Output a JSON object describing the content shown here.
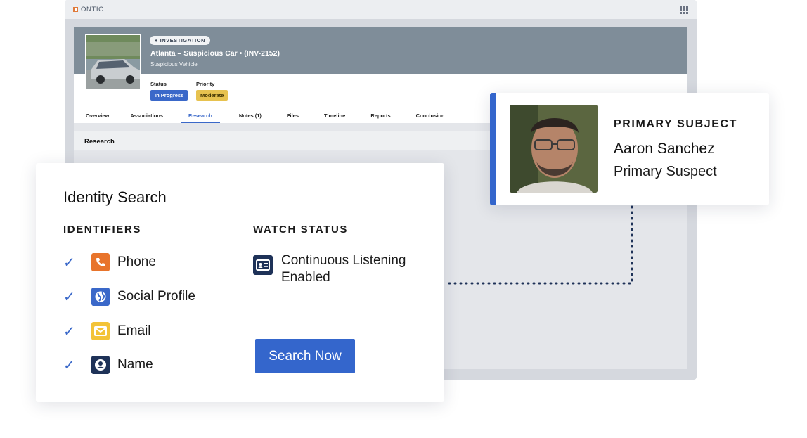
{
  "app": {
    "brand": "ONTIC"
  },
  "case": {
    "badge": "INVESTIGATION",
    "title": "Atlanta – Suspicious Car • (INV-2152)",
    "subtitle": "Suspicious Vehicle",
    "status_label": "Status",
    "status_value": "In Progress",
    "priority_label": "Priority",
    "priority_value": "Moderate",
    "tabs": [
      {
        "label": "Overview"
      },
      {
        "label": "Associations"
      },
      {
        "label": "Research"
      },
      {
        "label": "Notes (1)"
      },
      {
        "label": "Files"
      },
      {
        "label": "Timeline"
      },
      {
        "label": "Reports"
      },
      {
        "label": "Conclusion"
      }
    ],
    "active_tab": "Research",
    "section_title": "Research"
  },
  "identity_search": {
    "title": "Identity Search",
    "identifiers_heading": "IDENTIFIERS",
    "identifiers": [
      {
        "label": "Phone",
        "icon": "phone-icon",
        "color": "#e8742b"
      },
      {
        "label": "Social Profile",
        "icon": "globe-icon",
        "color": "#3a68c9"
      },
      {
        "label": "Email",
        "icon": "envelope-icon",
        "color": "#f3c338"
      },
      {
        "label": "Name",
        "icon": "person-icon",
        "color": "#1e3258"
      }
    ],
    "watch_heading": "WATCH STATUS",
    "watch_status": "Continuous Listening Enabled",
    "search_button": "Search Now"
  },
  "subject": {
    "heading": "PRIMARY SUBJECT",
    "name": "Aaron Sanchez",
    "role": "Primary Suspect"
  },
  "colors": {
    "accent": "#3466cc",
    "navy": "#1e3258",
    "status_blue": "#3a68c9",
    "priority_yellow": "#e7c24f"
  }
}
